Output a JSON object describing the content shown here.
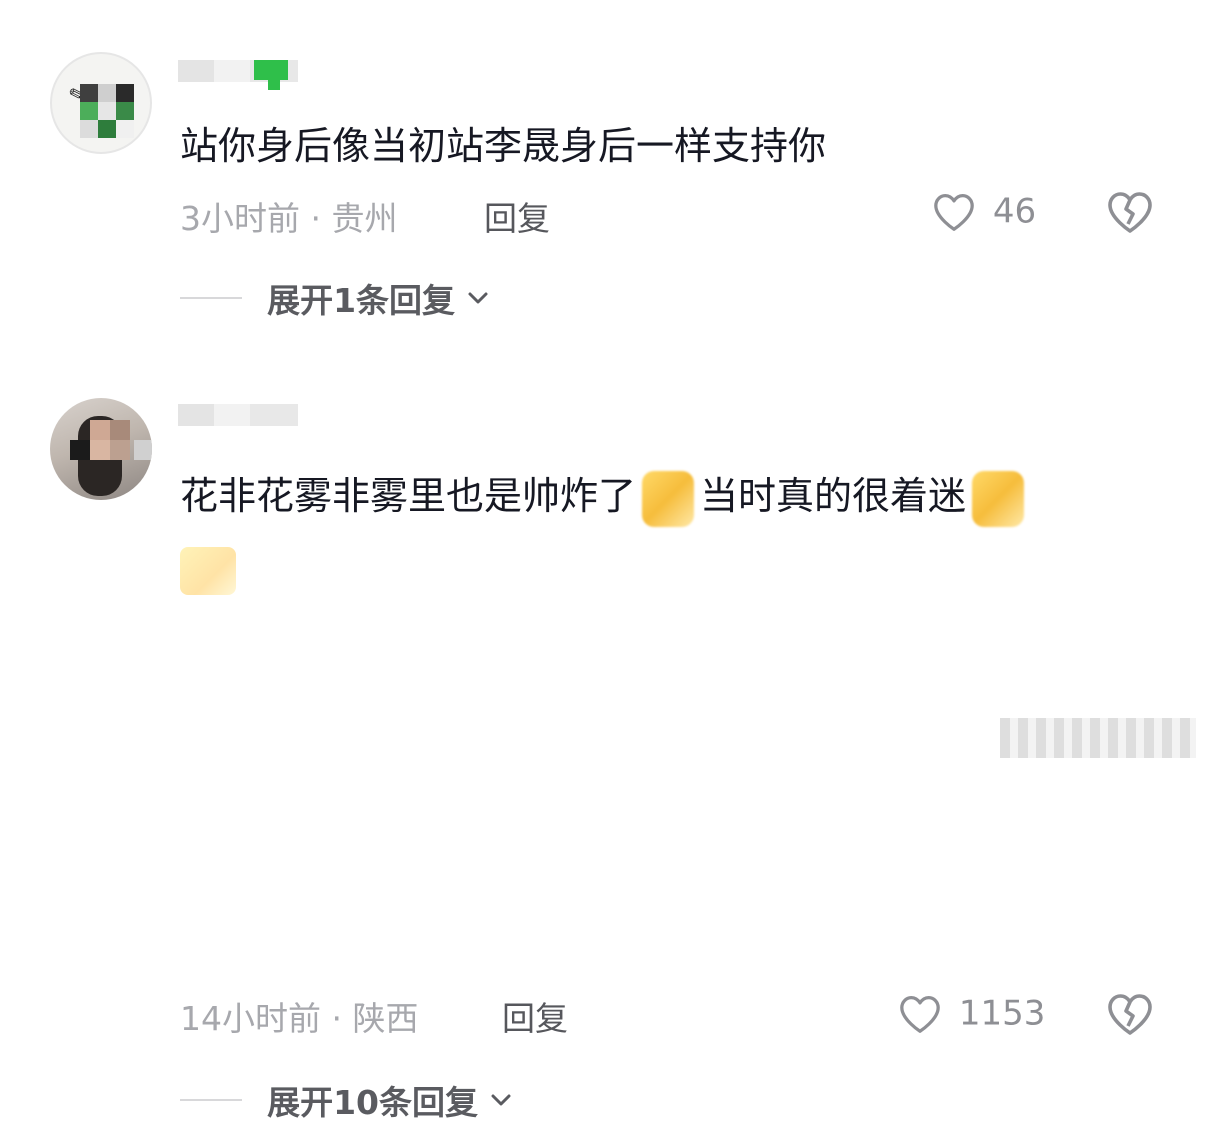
{
  "comments": [
    {
      "text": "站你身后像当初站李晟身后一样支持你",
      "time": "3小时前",
      "location": "贵州",
      "reply_label": "回复",
      "likes": "46",
      "expand_label": "展开1条回复",
      "badge_color": "#2fbf4a"
    },
    {
      "text_part1": "花非花雾非雾里也是帅炸了",
      "text_part2": "当时真的很着迷",
      "time": "14小时前",
      "location": "陕西",
      "reply_label": "回复",
      "likes": "1153",
      "expand_label": "展开10条回复"
    }
  ],
  "icons": {
    "like": "heart-outline-icon",
    "dislike": "broken-heart-icon",
    "expand": "chevron-down-icon"
  },
  "colors": {
    "text": "#161823",
    "meta": "#a7a8ad",
    "secondary": "#56575c"
  }
}
